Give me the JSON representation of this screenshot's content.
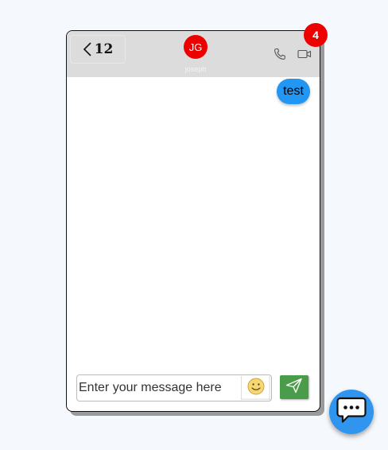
{
  "header": {
    "back_count": "12",
    "avatar_initials": "JG",
    "contact_name": "joseph",
    "back_icon": "chevron-left-icon",
    "call_icon": "phone-icon",
    "video_icon": "video-camera-icon"
  },
  "messages": [
    {
      "direction": "outgoing",
      "text": "test"
    }
  ],
  "composer": {
    "placeholder": "Enter your message here",
    "value": "",
    "emoji_icon": "smiley-face-icon",
    "send_icon": "paper-plane-icon"
  },
  "notification": {
    "count": "4"
  },
  "launcher": {
    "icon": "chat-bubble-icon"
  },
  "colors": {
    "header_bg": "#dcdcdc",
    "avatar_bg": "#ee0000",
    "outgoing_bubble": "#2196f3",
    "send_button": "#4a9c4a",
    "badge": "#ee0000",
    "launcher": "#2f95ee"
  }
}
